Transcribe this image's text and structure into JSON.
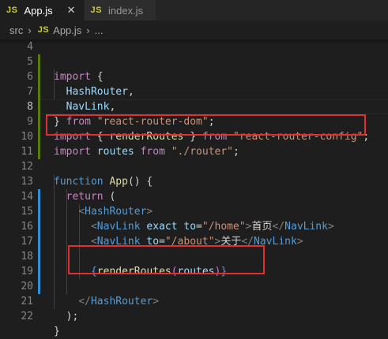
{
  "tabs": [
    {
      "badge": "JS",
      "label": "App.js",
      "close": "✕",
      "active": true
    },
    {
      "badge": "JS",
      "label": "index.js",
      "active": false
    }
  ],
  "breadcrumb": {
    "folder": "src",
    "badge": "JS",
    "file": "App.js",
    "more": "..."
  },
  "lines": [
    {
      "n": "4"
    },
    {
      "n": "5"
    },
    {
      "n": "6"
    },
    {
      "n": "7"
    },
    {
      "n": "8"
    },
    {
      "n": "9"
    },
    {
      "n": "10"
    },
    {
      "n": "11"
    },
    {
      "n": "12"
    },
    {
      "n": "13"
    },
    {
      "n": "14"
    },
    {
      "n": "15"
    },
    {
      "n": "16"
    },
    {
      "n": "17"
    },
    {
      "n": "18"
    },
    {
      "n": "19"
    },
    {
      "n": "20"
    },
    {
      "n": "21"
    },
    {
      "n": "22"
    }
  ],
  "code": {
    "l5": {
      "kw": "import",
      "p": " {"
    },
    "l6": {
      "v": "HashRouter",
      "p": ","
    },
    "l7": {
      "v": "NavLink",
      "p": ","
    },
    "l8": {
      "p": "} ",
      "kw": "from",
      "s": "\"react-router-dom\"",
      "e": ";"
    },
    "l9": {
      "kw": "import",
      "p1": " { ",
      "fn": "renderRoutes",
      "p2": " } ",
      "kw2": "from",
      "s": "\"react-router-config\"",
      "e": ";"
    },
    "l10": {
      "kw": "import",
      "v": " routes ",
      "kw2": "from",
      "s": " \"./router\"",
      "e": ";"
    },
    "l12": {
      "kw": "function",
      "fn": " App",
      "p": "() {"
    },
    "l13": {
      "kw": "return",
      "p": " ("
    },
    "l14": {
      "lt": "<",
      "tag": "HashRouter",
      "gt": ">"
    },
    "l15": {
      "lt": "<",
      "tag": "NavLink",
      "a1": " exact",
      "a2": " to",
      "eq": "=",
      "s": "\"/home\"",
      "gt": ">",
      "t": "首页",
      "close_lt": "</",
      "close_tag": "NavLink",
      "close_gt": ">"
    },
    "l16": {
      "lt": "<",
      "tag": "NavLink",
      "a2": " to",
      "eq": "=",
      "s": "\"/about\"",
      "gt": ">",
      "t": "关于",
      "close_lt": "</",
      "close_tag": "NavLink",
      "close_gt": ">"
    },
    "l18": {
      "b1": "{",
      "fn": "renderRoutes",
      "p1": "(",
      "v": "routes",
      "p2": ")",
      "b2": "}"
    },
    "l20": {
      "close_lt": "</",
      "close_tag": "HashRouter",
      "close_gt": ">"
    },
    "l21": {
      "p": ");"
    },
    "l22": {
      "p": "}"
    }
  },
  "colors": {
    "highlight_box": "#e03030",
    "git_modified": "#2f8fd6",
    "git_added": "#587c0c"
  }
}
